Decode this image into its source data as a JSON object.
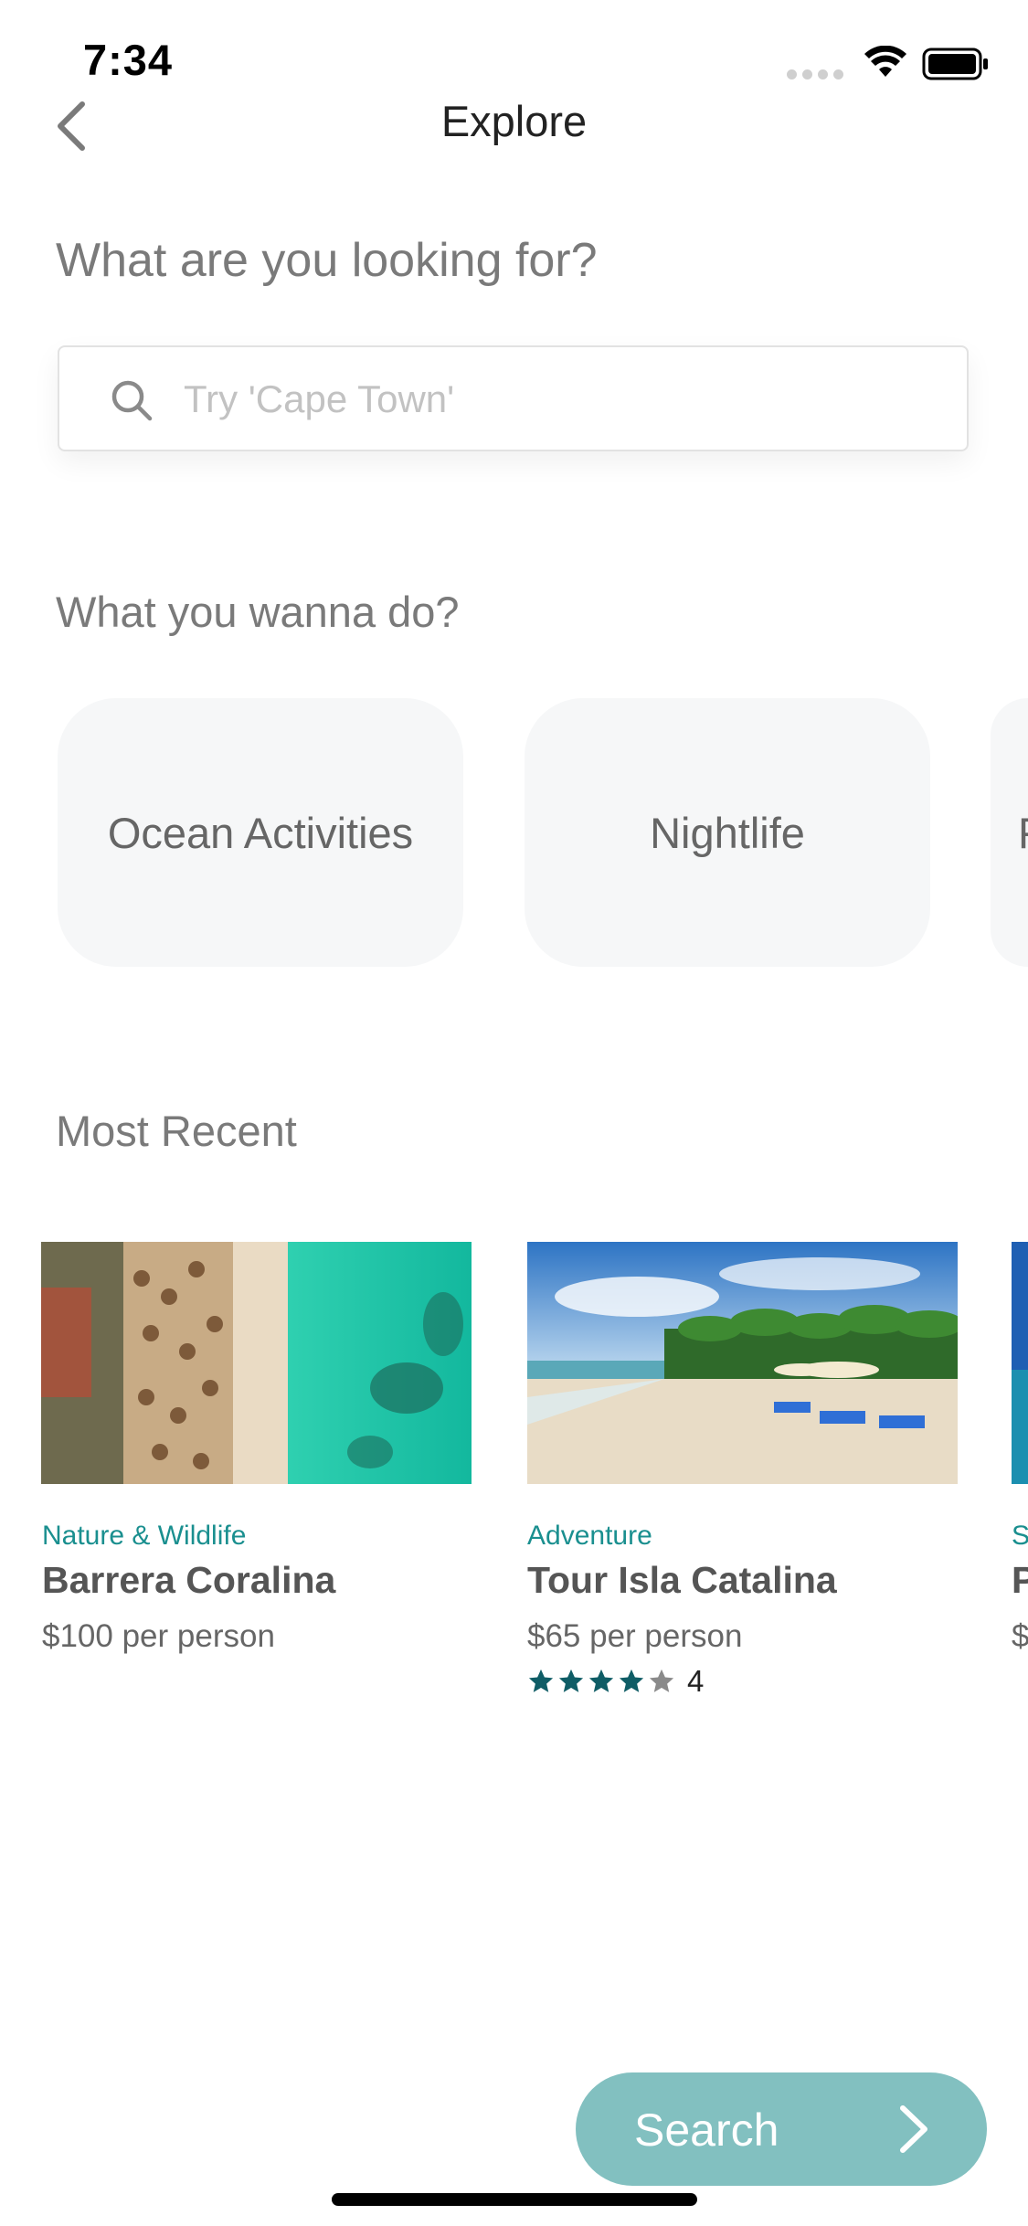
{
  "status_bar": {
    "time": "7:34"
  },
  "nav": {
    "title": "Explore",
    "back_icon": "chevron-left-icon"
  },
  "search_section": {
    "heading": "What are you looking for?",
    "placeholder": "Try 'Cape Town'",
    "icon": "search-icon"
  },
  "activities": {
    "heading": "What you wanna do?",
    "items": [
      {
        "label": "Ocean Activities"
      },
      {
        "label": "Nightlife"
      },
      {
        "label": "F"
      }
    ]
  },
  "recent": {
    "heading": "Most Recent",
    "items": [
      {
        "category": "Nature & Wildlife",
        "title": "Barrera Coralina",
        "price": "$100 per person",
        "image": "aerial beach photo"
      },
      {
        "category": "Adventure",
        "title": "Tour Isla Catalina",
        "price": "$65 per person",
        "rating": 4,
        "rating_label": "4",
        "image": "beach with palm trees photo"
      },
      {
        "category": "S",
        "title": "P",
        "price": "$",
        "image": "ocean photo"
      }
    ]
  },
  "footer": {
    "search_button_label": "Search",
    "search_button_icon": "chevron-right-icon"
  },
  "colors": {
    "accent": "#1a8f8f",
    "button": "#82c0c0",
    "star_filled": "#0f5d66",
    "star_empty": "#8a8a8a",
    "card_bg": "#f6f7f8"
  }
}
